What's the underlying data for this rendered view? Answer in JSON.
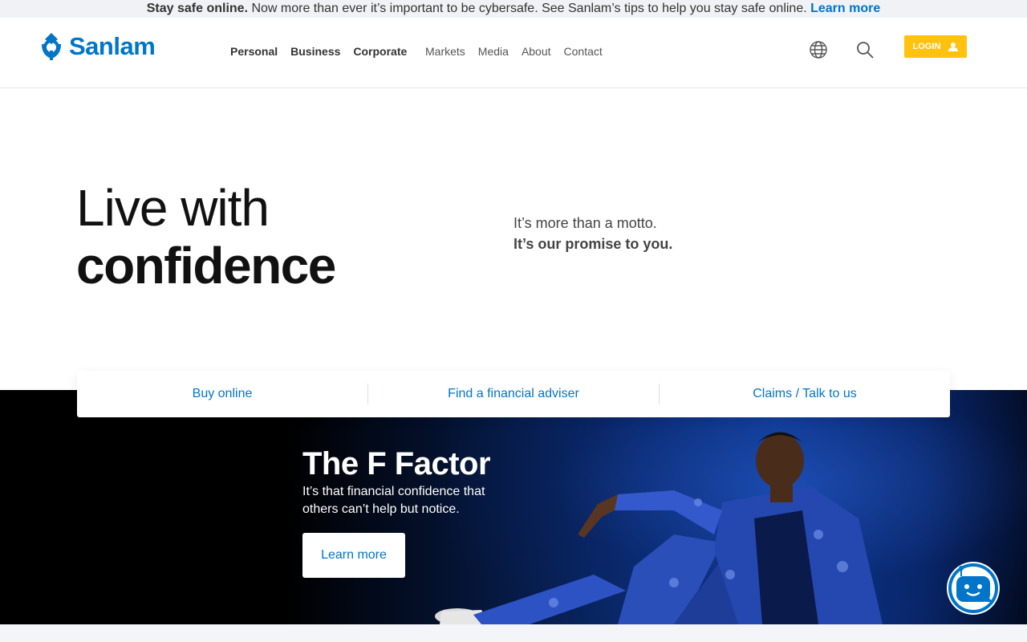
{
  "alert": {
    "lead": "Stay safe online.",
    "message": " Now more than ever it’s important to be cybersafe. See Sanlam’s tips to help you stay safe online. ",
    "link": "Learn more"
  },
  "header": {
    "logo_text": "Sanlam",
    "nav_primary": [
      "Personal",
      "Business",
      "Corporate"
    ],
    "nav_secondary": [
      "Markets",
      "Media",
      "About",
      "Contact"
    ],
    "login_label": "LOGIN"
  },
  "hero": {
    "title_line1": "Live with",
    "title_line2": "confidence",
    "sub_line1": "It’s more than a motto.",
    "sub_line2": "It’s our promise to you."
  },
  "quick_links": [
    "Buy online",
    "Find a financial adviser",
    "Claims / Talk to us"
  ],
  "banner": {
    "title": "The F Factor",
    "text": "It’s that financial confidence that others can’t help but notice.",
    "button": "Learn more"
  },
  "colors": {
    "brand_blue": "#0075c9",
    "login_yellow": "#ffc20e",
    "banner_dark": "#000000"
  },
  "icons": [
    "sanlam-logo-icon",
    "globe-icon",
    "search-icon",
    "user-icon",
    "chatbot-icon"
  ]
}
